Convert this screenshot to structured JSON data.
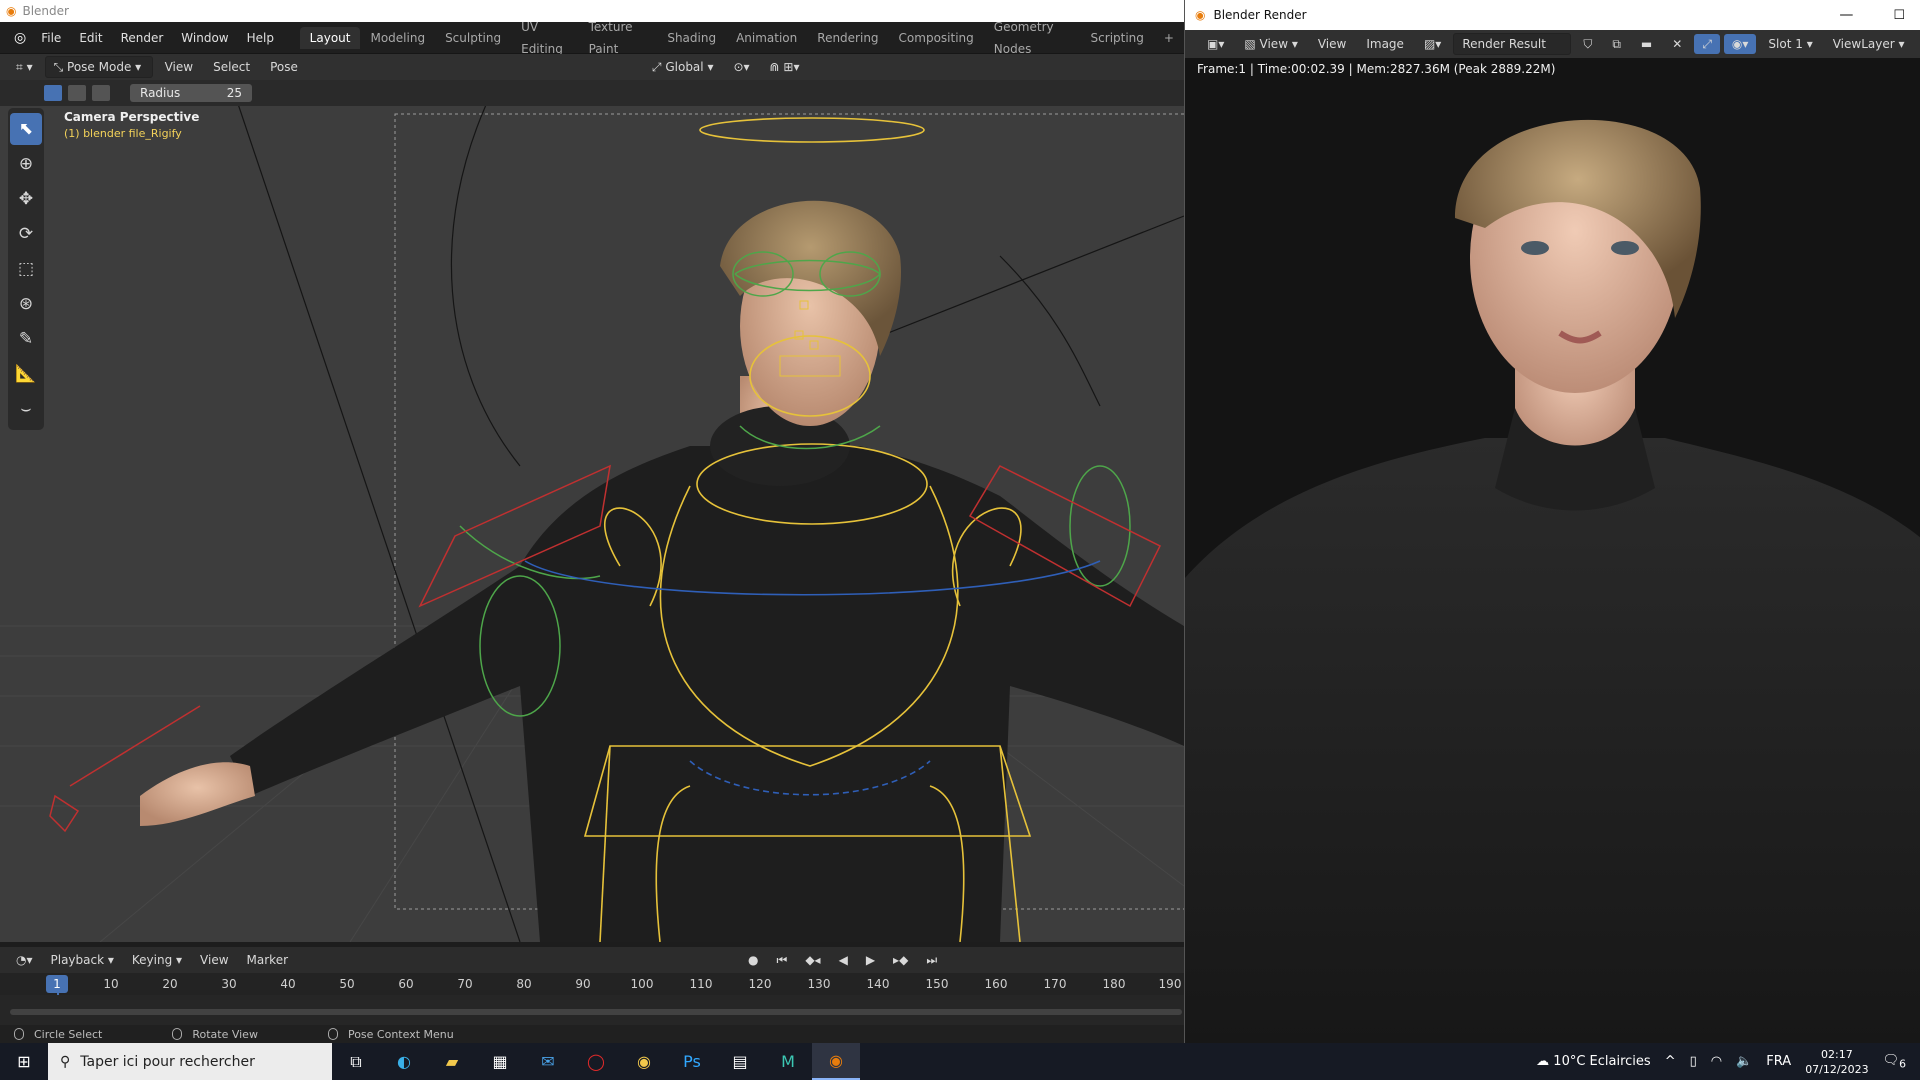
{
  "main_window": {
    "title": "Blender",
    "menu": [
      "File",
      "Edit",
      "Render",
      "Window",
      "Help"
    ],
    "workspaces": [
      "Layout",
      "Modeling",
      "Sculpting",
      "UV Editing",
      "Texture Paint",
      "Shading",
      "Animation",
      "Rendering",
      "Compositing",
      "Geometry Nodes",
      "Scripting"
    ],
    "active_workspace": "Layout",
    "add_workspace": "+"
  },
  "header": {
    "mode": "Pose Mode",
    "menus": [
      "View",
      "Select",
      "Pose"
    ],
    "transform_orientation": "Global"
  },
  "tool_settings": {
    "radius_label": "Radius",
    "radius_value": "25"
  },
  "viewport": {
    "camera_label": "Camera Perspective",
    "object_label": "(1) blender file_Rigify"
  },
  "toolbar": [
    "select-circle-icon",
    "cursor-icon",
    "move-icon",
    "rotate-icon",
    "scale-icon",
    "transform-icon",
    "annotate-icon",
    "measure-icon",
    "relax-pose-icon"
  ],
  "timeline": {
    "menus": [
      "Playback",
      "Keying",
      "View",
      "Marker"
    ],
    "current_frame": "1",
    "frame_ticks": [
      "10",
      "20",
      "30",
      "40",
      "50",
      "60",
      "70",
      "80",
      "90",
      "100",
      "110",
      "120",
      "130",
      "140",
      "150",
      "160",
      "170",
      "180",
      "190"
    ]
  },
  "status_bar": {
    "left": "Circle Select",
    "middle": "Rotate View",
    "right": "Pose Context Menu"
  },
  "render_window": {
    "title": "Blender Render",
    "menus": [
      "View",
      "View",
      "Image"
    ],
    "image_name": "Render Result",
    "slot": "Slot 1",
    "view_layer": "ViewLayer",
    "info": "Frame:1 | Time:00:02.39 | Mem:2827.36M (Peak 2889.22M)"
  },
  "taskbar": {
    "search_placeholder": "Taper ici pour rechercher",
    "weather": "10°C  Eclaircies",
    "language": "FRA",
    "time": "02:17",
    "date": "07/12/2023",
    "notification_count": "6"
  },
  "colors": {
    "accent": "#4772b3",
    "rig_yellow": "#e6c23a",
    "rig_green": "#4ea64a",
    "rig_red": "#c03030",
    "rig_blue": "#2f5fb8"
  }
}
